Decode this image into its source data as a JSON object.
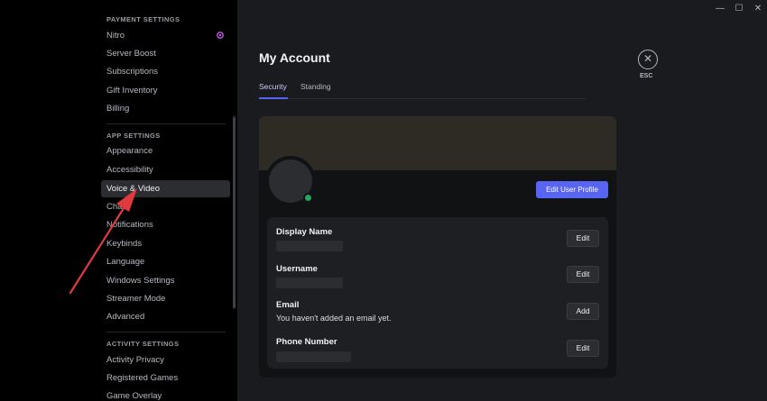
{
  "sidebar": {
    "payment_header": "PAYMENT SETTINGS",
    "payment_items": [
      {
        "label": "Nitro"
      },
      {
        "label": "Server Boost"
      },
      {
        "label": "Subscriptions"
      },
      {
        "label": "Gift Inventory"
      },
      {
        "label": "Billing"
      }
    ],
    "app_header": "APP SETTINGS",
    "app_items": [
      {
        "label": "Appearance"
      },
      {
        "label": "Accessibility"
      },
      {
        "label": "Voice & Video"
      },
      {
        "label": "Chat"
      },
      {
        "label": "Notifications"
      },
      {
        "label": "Keybinds"
      },
      {
        "label": "Language"
      },
      {
        "label": "Windows Settings"
      },
      {
        "label": "Streamer Mode"
      },
      {
        "label": "Advanced"
      }
    ],
    "activity_header": "ACTIVITY SETTINGS",
    "activity_items": [
      {
        "label": "Activity Privacy"
      },
      {
        "label": "Registered Games"
      },
      {
        "label": "Game Overlay"
      }
    ]
  },
  "main": {
    "title": "My Account",
    "tabs": [
      {
        "label": "Security",
        "active": true
      },
      {
        "label": "Standing",
        "active": false
      }
    ],
    "esc_label": "ESC",
    "edit_profile_label": "Edit User Profile",
    "fields": [
      {
        "label": "Display Name",
        "value": "",
        "button": "Edit"
      },
      {
        "label": "Username",
        "value": "",
        "button": "Edit"
      },
      {
        "label": "Email",
        "value": "You haven't added an email yet.",
        "button": "Add"
      },
      {
        "label": "Phone Number",
        "value": "",
        "button": "Edit"
      }
    ]
  },
  "window": {
    "minimize": "—",
    "maximize": "☐",
    "close": "✕"
  },
  "colors": {
    "accent": "#5865f2",
    "online": "#23a55a",
    "annotation_arrow": "#e03a3e"
  }
}
